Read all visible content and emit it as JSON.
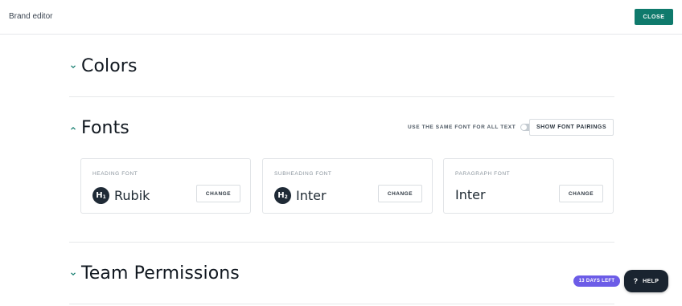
{
  "header": {
    "title": "Brand editor",
    "close_label": "CLOSE"
  },
  "sections": {
    "colors": {
      "title": "Colors",
      "expanded": false
    },
    "fonts": {
      "title": "Fonts",
      "expanded": true,
      "same_font_label": "USE THE SAME FONT FOR ALL TEXT",
      "same_font_enabled": false,
      "pairings_label": "SHOW FONT PAIRINGS",
      "cards": [
        {
          "label": "HEADING FONT",
          "badge": "H1",
          "font": "Rubik",
          "change_label": "CHANGE"
        },
        {
          "label": "SUBHEADING FONT",
          "badge": "H2",
          "font": "Inter",
          "change_label": "CHANGE"
        },
        {
          "label": "PARAGRAPH FONT",
          "badge": "",
          "font": "Inter",
          "change_label": "CHANGE"
        }
      ]
    },
    "team_permissions": {
      "title": "Team Permissions",
      "expanded": false
    }
  },
  "trial": {
    "label": "13 DAYS LEFT"
  },
  "help": {
    "icon": "?",
    "label": "HELP"
  },
  "colors": {
    "accent": "#0f7a6c",
    "trial": "#6c5ce7",
    "dark": "#1a2430"
  },
  "icons": [
    "chevron-down-icon",
    "chevron-up-icon",
    "heading-1-icon",
    "heading-2-icon",
    "question-icon"
  ]
}
